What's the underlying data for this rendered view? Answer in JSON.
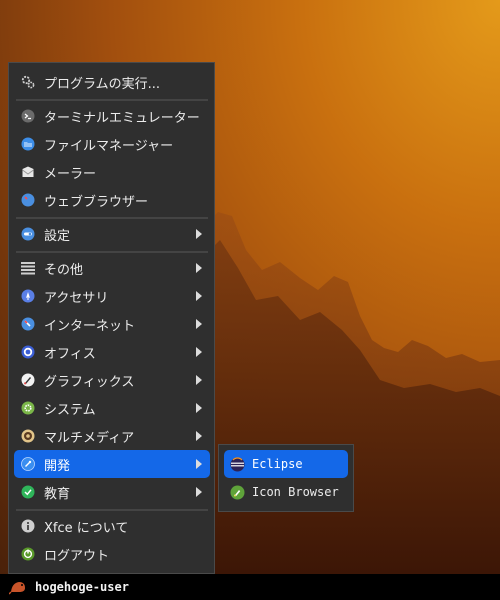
{
  "menu": {
    "items": [
      {
        "label": "プログラムの実行...",
        "icon": "gears-icon"
      },
      {
        "label": "ターミナルエミュレーター",
        "icon": "terminal-icon"
      },
      {
        "label": "ファイルマネージャー",
        "icon": "folder-icon"
      },
      {
        "label": "メーラー",
        "icon": "mail-icon"
      },
      {
        "label": "ウェブブラウザー",
        "icon": "compass-icon"
      },
      {
        "label": "設定",
        "icon": "settings-toggle-icon"
      },
      {
        "label": "その他",
        "icon": "list-icon"
      },
      {
        "label": "アクセサリ",
        "icon": "accessories-icon"
      },
      {
        "label": "インターネット",
        "icon": "globe-icon"
      },
      {
        "label": "オフィス",
        "icon": "office-icon"
      },
      {
        "label": "グラフィックス",
        "icon": "graphics-icon"
      },
      {
        "label": "システム",
        "icon": "system-gear-icon"
      },
      {
        "label": "マルチメディア",
        "icon": "multimedia-icon"
      },
      {
        "label": "開発",
        "icon": "development-icon"
      },
      {
        "label": "教育",
        "icon": "education-icon"
      },
      {
        "label": "Xfce について",
        "icon": "info-icon"
      },
      {
        "label": "ログアウト",
        "icon": "logout-icon"
      }
    ]
  },
  "submenu": {
    "items": [
      {
        "label": "Eclipse",
        "icon": "eclipse-icon"
      },
      {
        "label": "Icon Browser",
        "icon": "icon-browser-icon"
      }
    ]
  },
  "taskbar": {
    "username": "hogehoge-user",
    "logo_icon": "xfce-mouse-icon"
  },
  "colors": {
    "menu_bg": "#2f2f2f",
    "highlight": "#1468e8",
    "taskbar_bg": "#000000"
  }
}
